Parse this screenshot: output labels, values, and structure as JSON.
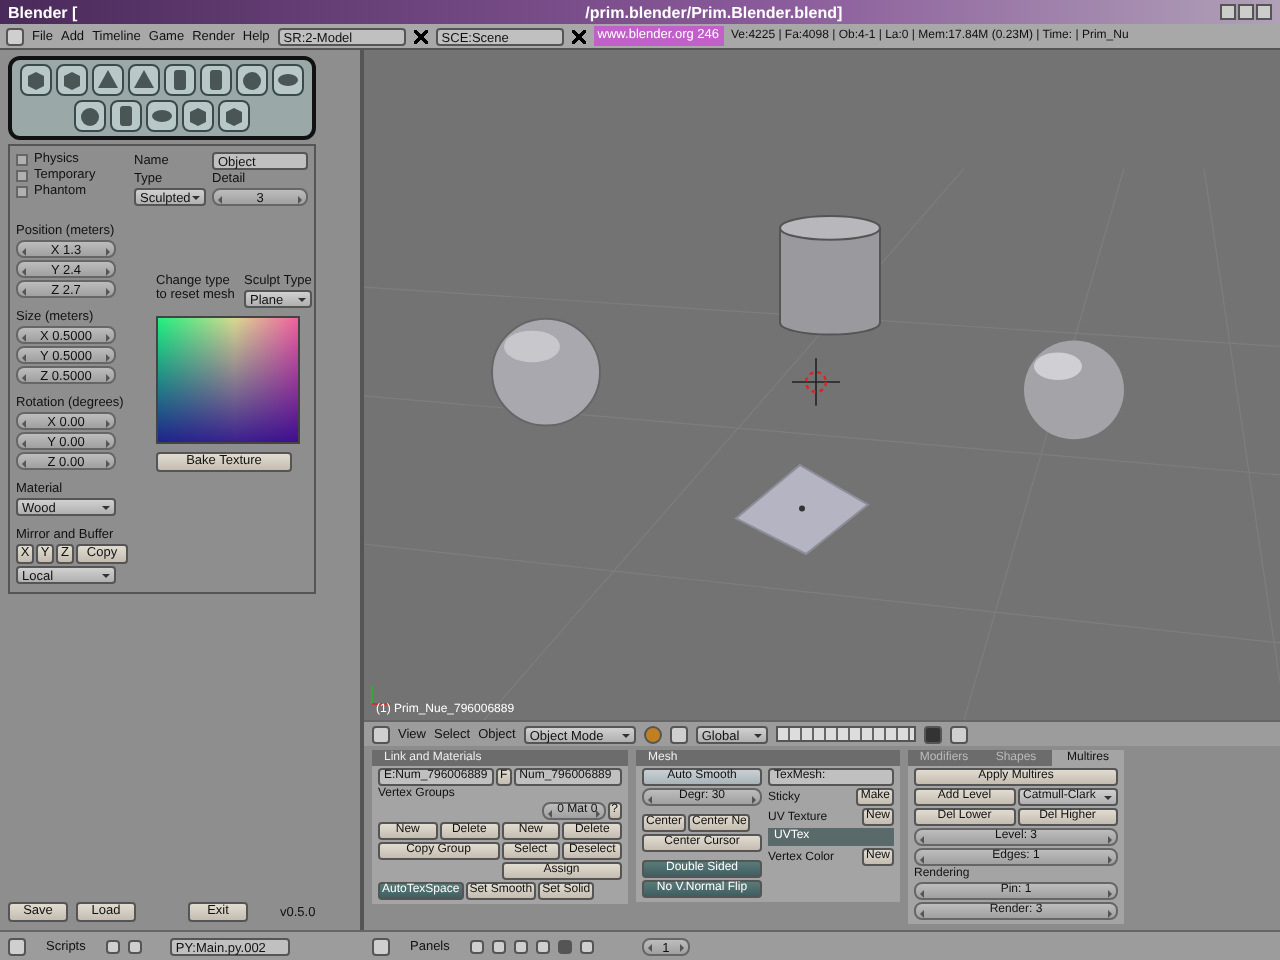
{
  "window": {
    "title": "Blender [",
    "path": "/prim.blender/Prim.Blender.blend]"
  },
  "menu_bar": {
    "menus": [
      "File",
      "Add",
      "Timeline",
      "Game",
      "Render",
      "Help"
    ],
    "screen": "SR:2-Model",
    "scene": "SCE:Scene",
    "link": "www.blender.org 246",
    "stats": "Ve:4225 | Fa:4098 | Ob:4-1 | La:0 | Mem:17.84M (0.23M) | Time: | Prim_Nu"
  },
  "script_panel": {
    "options": [
      {
        "label": "Physics",
        "checked": false
      },
      {
        "label": "Temporary",
        "checked": false
      },
      {
        "label": "Phantom",
        "checked": false
      }
    ],
    "name_label": "Name",
    "name": "Object",
    "type_label": "Type",
    "type": "Sculpted",
    "detail_label": "Detail",
    "detail": "3",
    "position": {
      "title": "Position (meters)",
      "fields": [
        "X 1.3",
        "Y 2.4",
        "Z 2.7"
      ]
    },
    "size": {
      "title": "Size (meters)",
      "fields": [
        "X 0.5000",
        "Y 0.5000",
        "Z 0.5000"
      ]
    },
    "rotation": {
      "title": "Rotation (degrees)",
      "fields": [
        "X 0.00",
        "Y 0.00",
        "Z 0.00"
      ]
    },
    "change_note": "Change type to reset mesh",
    "sculpt_type_label": "Sculpt Type",
    "sculpt_type": "Plane",
    "bake_button": "Bake Texture",
    "material_label": "Material",
    "material": "Wood",
    "mirror_label": "Mirror and Buffer",
    "mirror_axes": [
      "X",
      "Y",
      "Z"
    ],
    "copy_button": "Copy",
    "space": "Local",
    "buttons": [
      "Save",
      "Load",
      "Exit"
    ],
    "version": "v0.5.0"
  },
  "script_header": {
    "title": "Scripts",
    "script": "PY:Main.py.002"
  },
  "viewport": {
    "object_label": "(1) Prim_Nue_796006889"
  },
  "viewport_header": {
    "menus": [
      "View",
      "Select",
      "Object"
    ],
    "mode": "Object Mode",
    "orientation": "Global"
  },
  "link_materials": {
    "title": "Link and Materials",
    "mesh_name": "E:Num_796006889",
    "f_button": "F",
    "object_name": "Num_796006889",
    "vertex_groups": "Vertex Groups",
    "mat_index": "0 Mat 0",
    "help": "?",
    "left_buttons": [
      "New",
      "Delete",
      "Copy Group"
    ],
    "right_buttons": [
      "New",
      "Delete",
      "Select",
      "Deselect",
      "Assign"
    ],
    "auto_tex_space": {
      "label": "AutoTexSpace",
      "on": true
    },
    "buttons": [
      "Set Smooth",
      "Set Solid"
    ]
  },
  "mesh": {
    "title": "Mesh",
    "auto_smooth": {
      "label": "Auto Smooth",
      "on": false
    },
    "degree": "Degr: 30",
    "center_buttons": [
      "Center",
      "Center Ne",
      "Center Cursor"
    ],
    "double_sided": {
      "label": "Double Sided",
      "on": true
    },
    "no_vnormal_flip": {
      "label": "No V.Normal Flip",
      "on": true
    },
    "texmesh": "TexMesh:",
    "sticky_label": "Sticky",
    "sticky_button": "Make",
    "uv_label": "UV Texture",
    "uv_button": "New",
    "uv_layer": "UVTex",
    "vcol_label": "Vertex Color",
    "vcol_button": "New"
  },
  "multires": {
    "tabs": [
      {
        "label": "Modifiers",
        "selected": false
      },
      {
        "label": "Shapes",
        "selected": false
      },
      {
        "label": "Multires",
        "selected": true
      }
    ],
    "apply": "Apply Multires",
    "add_level": "Add Level",
    "subdiv_type": "Catmull-Clark",
    "del_lower": "Del Lower",
    "del_higher": "Del Higher",
    "level": "Level: 3",
    "edges": "Edges: 1",
    "rendering": "Rendering",
    "pin": "Pin: 1",
    "render": "Render: 3"
  },
  "buttons_header": {
    "panels_label": "Panels",
    "frame": "1"
  }
}
